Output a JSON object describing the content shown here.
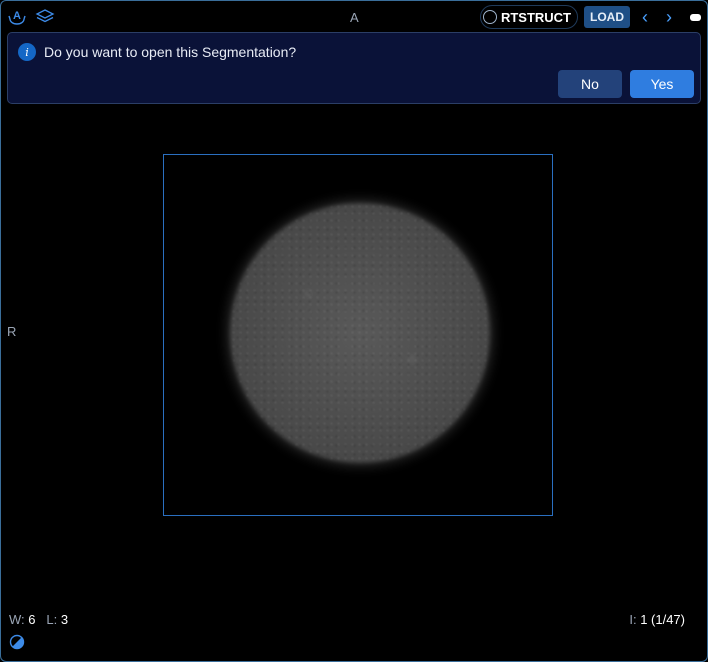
{
  "viewport": {
    "orientation_top": "A",
    "orientation_left": "R",
    "icons": [
      "tracking-icon",
      "layers-icon"
    ]
  },
  "toolbar": {
    "modality_label": "RTSTRUCT",
    "load_label": "LOAD",
    "prev_label": "‹",
    "next_label": "›"
  },
  "dialog": {
    "message": "Do you want to open this Segmentation?",
    "no_label": "No",
    "yes_label": "Yes",
    "info_glyph": "i"
  },
  "overlay": {
    "window_label": "W:",
    "window_value": "6",
    "level_label": "L:",
    "level_value": "3",
    "instance_label": "I:",
    "instance_value": "1 (1/47)"
  },
  "colors": {
    "accent": "#2f7de0",
    "frame": "#2a6fc0",
    "dialog_bg": "#0a1238"
  }
}
